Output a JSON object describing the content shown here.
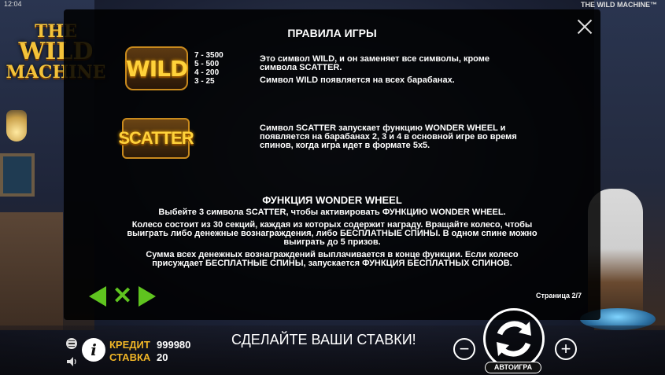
{
  "status": {
    "time": "12:04",
    "game_title": "THE WILD MACHINE™"
  },
  "logo": {
    "line1": "THE",
    "line2": "WILD",
    "line3": "MACHINE"
  },
  "modal": {
    "title": "ПРАВИЛА ИГРЫ",
    "wild": {
      "symbol": "WILD",
      "payouts": [
        "7 - 3500",
        "5 - 500",
        "4 - 200",
        "3 - 25"
      ],
      "line1": "Это символ WILD, и он заменяет все символы, кроме символа SCATTER.",
      "line2": "Символ WILD появляется на всех барабанах."
    },
    "scatter": {
      "symbol": "SCATTER",
      "text": "Символ SCATTER запускает функцию WONDER WHEEL и появляется на барабанах 2, 3 и 4 в основной игре во время спинов, когда игра идет в формате 5x5."
    },
    "feature": {
      "title": "ФУНКЦИЯ WONDER WHEEL",
      "p1": "Выбейте 3 символа SCATTER, чтобы активировать ФУНКЦИЮ WONDER WHEEL.",
      "p2": "Колесо состоит из 30 секций, каждая из которых содержит награду. Вращайте колесо, чтобы выиграть либо денежные вознаграждения, либо БЕСПЛАТНЫЕ СПИНЫ. В одном спине можно выиграть до 5 призов.",
      "p3": "Сумма всех денежных вознаграждений выплачивается в конце функции. Если колесо присуждает БЕСПЛАТНЫЕ СПИНЫ, запускается ФУНКЦИЯ БЕСПЛАТНЫХ СПИНОВ."
    },
    "page": "Страница 2/7"
  },
  "bottom": {
    "credit_label": "КРЕДИТ",
    "credit_value": "999980",
    "bet_label": "СТАВКА",
    "bet_value": "20",
    "message": "СДЕЛАЙТЕ ВАШИ СТАВКИ!",
    "minus": "−",
    "plus": "+",
    "autoplay": "АВТОИГРА",
    "info": "i"
  },
  "colors": {
    "accent_gold": "#f0b526",
    "nav_green": "#5fc41f"
  }
}
